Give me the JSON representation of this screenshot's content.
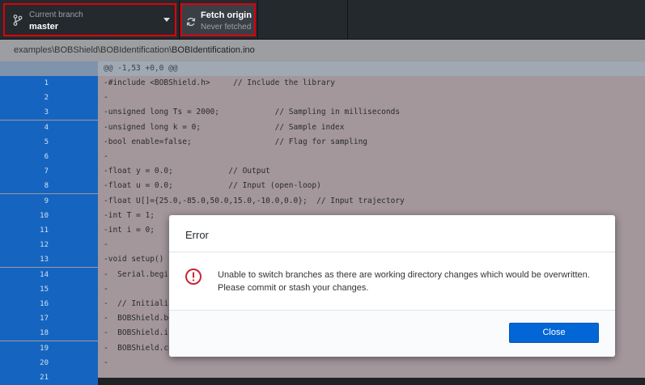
{
  "toolbar": {
    "branch": {
      "label": "Current branch",
      "value": "master"
    },
    "fetch": {
      "label": "Fetch origin",
      "status": "Never fetched"
    }
  },
  "breadcrumb": {
    "path": "examples\\BOBShield\\BOBIdentification\\",
    "file": "BOBIdentification.ino"
  },
  "diff": {
    "hunk_header": "@@ -1,53 +0,0 @@",
    "lines": [
      {
        "n": "1",
        "text": "-#include <BOBShield.h>     // Include the library"
      },
      {
        "n": "2",
        "text": "-"
      },
      {
        "n": "3",
        "text": "-unsigned long Ts = 2000;            // Sampling in milliseconds"
      },
      {
        "n": "4",
        "text": "-unsigned long k = 0;                // Sample index"
      },
      {
        "n": "5",
        "text": "-bool enable=false;                  // Flag for sampling"
      },
      {
        "n": "6",
        "text": "-"
      },
      {
        "n": "7",
        "text": "-float y = 0.0;            // Output"
      },
      {
        "n": "8",
        "text": "-float u = 0.0;            // Input (open-loop)"
      },
      {
        "n": "9",
        "text": "-float U[]={25.0,-85.0,50.0,15.0,-10.0,0.0};  // Input trajectory"
      },
      {
        "n": "10",
        "text": "-int T = 1;"
      },
      {
        "n": "11",
        "text": "-int i = 0;"
      },
      {
        "n": "12",
        "text": "-"
      },
      {
        "n": "13",
        "text": "-void setup() {"
      },
      {
        "n": "14",
        "text": "-  Serial.begin"
      },
      {
        "n": "15",
        "text": "-"
      },
      {
        "n": "16",
        "text": "-  // Initializ"
      },
      {
        "n": "17",
        "text": "-  BOBShield.be"
      },
      {
        "n": "18",
        "text": "-  BOBShield.in"
      },
      {
        "n": "19",
        "text": "-  BOBShield.ca"
      },
      {
        "n": "20",
        "text": "-"
      },
      {
        "n": "21",
        "text": ""
      }
    ]
  },
  "modal": {
    "title": "Error",
    "message": "Unable to switch branches as there are working directory changes which would be overwritten. Please commit or stash your changes.",
    "close_label": "Close"
  },
  "colors": {
    "accent": "#0366d6",
    "highlight_border": "#e0000a",
    "error_icon": "#cb2431",
    "line_gutter": "#1565c0"
  },
  "icons": {
    "branch": "git-branch-icon",
    "fetch": "sync-icon",
    "error": "alert-circle-icon"
  }
}
